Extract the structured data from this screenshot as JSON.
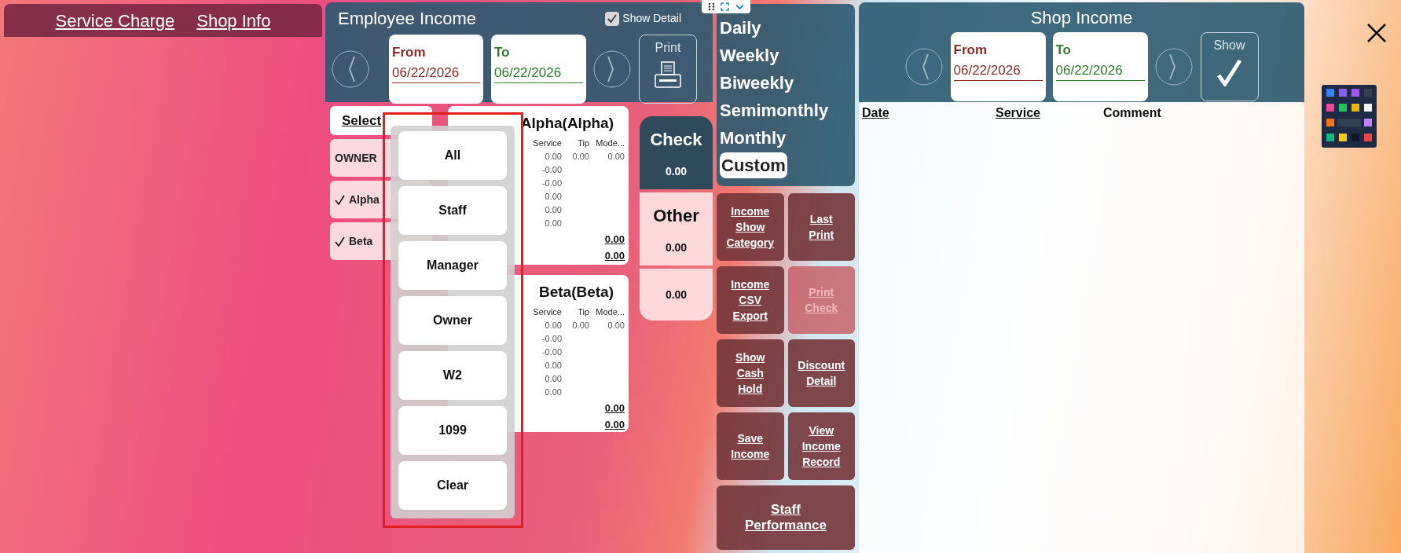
{
  "top_links": [
    "Service Charge",
    "Shop Info"
  ],
  "employee_income": {
    "title": "Employee Income",
    "show_detail": {
      "label": "Show Detail",
      "checked": true
    },
    "from": {
      "label": "From",
      "value": "06/22/2026"
    },
    "to": {
      "label": "To",
      "value": "06/22/2026"
    },
    "print_label": "Print"
  },
  "select_label": "Select",
  "employees": [
    {
      "label": "OWNER",
      "checked": false
    },
    {
      "label": "Alpha",
      "checked": true
    },
    {
      "label": "Beta",
      "checked": true
    }
  ],
  "dropdown": [
    "All",
    "Staff",
    "Manager",
    "Owner",
    "W2",
    "1099",
    "Clear"
  ],
  "cards": [
    {
      "title": "Alpha(Alpha)",
      "columns": [
        "Service",
        "Tip",
        "Mode..."
      ],
      "rows": [
        [
          "0.00",
          "0.00",
          "0.00"
        ],
        [
          "-0.00"
        ],
        [
          "-0.00"
        ],
        [
          "0.00"
        ],
        [
          "0.00"
        ],
        [
          "0.00"
        ]
      ],
      "totals": [
        "0.00",
        "0.00"
      ]
    },
    {
      "title": "Beta(Beta)",
      "columns": [
        "Service",
        "Tip",
        "Mode..."
      ],
      "rows": [
        [
          "0.00",
          "0.00",
          "0.00"
        ],
        [
          "-0.00"
        ],
        [
          "-0.00"
        ],
        [
          "0.00"
        ],
        [
          "0.00"
        ],
        [
          "0.00"
        ]
      ],
      "totals": [
        "0.00",
        "0.00"
      ]
    }
  ],
  "summary": [
    {
      "kind": "dark",
      "label": "Check",
      "value": "0.00"
    },
    {
      "kind": "light",
      "label": "Other",
      "value": "0.00"
    },
    {
      "kind": "light",
      "value": "0.00"
    }
  ],
  "periods": [
    {
      "label": "Daily",
      "selected": false
    },
    {
      "label": "Weekly",
      "selected": false
    },
    {
      "label": "Biweekly",
      "selected": false
    },
    {
      "label": "Semimonthly",
      "selected": false
    },
    {
      "label": "Monthly",
      "selected": false
    },
    {
      "label": "Custom",
      "selected": true
    }
  ],
  "actions": [
    {
      "label": "Income Show Category",
      "kind": "normal",
      "disabled": false
    },
    {
      "label": "Last Print",
      "kind": "normal",
      "disabled": false
    },
    {
      "label": "Income CSV Export",
      "kind": "normal",
      "disabled": false
    },
    {
      "label": "Print Check",
      "kind": "normal",
      "disabled": true
    },
    {
      "label": "Show Cash Hold",
      "kind": "normal",
      "disabled": false
    },
    {
      "label": "Discount Detail",
      "kind": "normal",
      "disabled": false
    },
    {
      "label": "Save Income",
      "kind": "normal",
      "disabled": false
    },
    {
      "label": "View Income Record",
      "kind": "normal",
      "disabled": false
    },
    {
      "label": "Staff Performance",
      "kind": "wide",
      "disabled": false
    }
  ],
  "shop_income": {
    "title": "Shop Income",
    "from": {
      "label": "From",
      "value": "06/22/2026"
    },
    "to": {
      "label": "To",
      "value": "06/22/2026"
    },
    "show_label": "Show",
    "columns": [
      {
        "label": "Date",
        "sortable": true
      },
      {
        "label": "Service",
        "sortable": true
      },
      {
        "label": "Comment",
        "sortable": false
      }
    ]
  }
}
